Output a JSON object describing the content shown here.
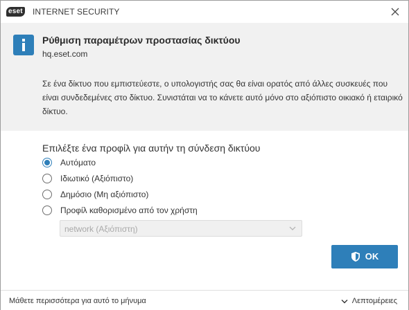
{
  "titlebar": {
    "logo_text": "eset",
    "product_name": "INTERNET SECURITY",
    "close_icon": "close-icon"
  },
  "header": {
    "icon": "info-icon",
    "title": "Ρύθμιση παραμέτρων προστασίας δικτύου",
    "subtitle": "hq.eset.com",
    "description": "Σε ένα δίκτυο που εμπιστεύεστε, ο υπολογιστής σας θα είναι ορατός από άλλες συσκευές που είναι συνδεδεμένες στο δίκτυο. Συνιστάται να το κάνετε αυτό μόνο στο αξιόπιστο οικιακό ή εταιρικό δίκτυο."
  },
  "profile": {
    "prompt": "Επιλέξτε ένα προφίλ για αυτήν τη σύνδεση δικτύου",
    "options": [
      {
        "label": "Αυτόματο",
        "checked": true
      },
      {
        "label": "Ιδιωτικό (Αξιόπιστο)",
        "checked": false
      },
      {
        "label": "Δημόσιο (Μη αξιόπιστο)",
        "checked": false
      },
      {
        "label": "Προφίλ καθορισμένο από τον χρήστη",
        "checked": false
      }
    ],
    "custom_select_value": "network (Αξιόπιστη)"
  },
  "actions": {
    "ok_label": "OK",
    "ok_icon": "shield-icon"
  },
  "footer": {
    "learn_more": "Μάθετε περισσότερα για αυτό το μήνυμα",
    "details": "Λεπτομέρειες",
    "details_icon": "chevron-down-icon"
  },
  "colors": {
    "accent": "#2e7fb9",
    "header_bg": "#f1f1f1"
  }
}
